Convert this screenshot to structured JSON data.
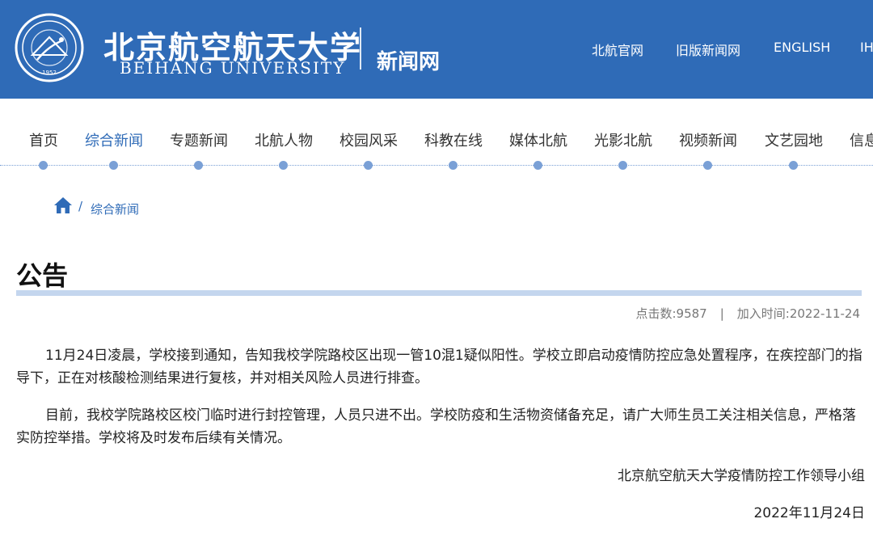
{
  "header": {
    "logo_cn": "北京航空航天大学",
    "logo_en": "BEIHANG UNIVERSITY",
    "site_name": "新闻网",
    "links": [
      "北航官网",
      "旧版新闻网",
      "ENGLISH",
      "IH"
    ]
  },
  "nav": {
    "items": [
      "首页",
      "综合新闻",
      "专题新闻",
      "北航人物",
      "校园风采",
      "科教在线",
      "媒体北航",
      "光影北航",
      "视频新闻",
      "文艺园地",
      "信息"
    ],
    "active": "综合新闻"
  },
  "breadcrumb": {
    "home_icon": "home-icon",
    "separator": "/",
    "current": "综合新闻"
  },
  "article": {
    "title": "公告",
    "views_label": "点击数:9587",
    "meta_separator": "|",
    "date_label": "加入时间:2022-11-24",
    "paragraphs": [
      "11月24日凌晨，学校接到通知，告知我校学院路校区出现一管10混1疑似阳性。学校立即启动疫情防控应急处置程序，在疾控部门的指导下，正在对核酸检测结果进行复核，并对相关风险人员进行排查。",
      "目前，我校学院路校区校门临时进行封控管理，人员只进不出。学校防疫和生活物资储备充足，请广大师生员工关注相关信息，严格落实防控举措。学校将及时发布后续有关情况。"
    ],
    "signature": "北京航空航天大学疫情防控工作领导小组",
    "date": "2022年11月24日"
  },
  "colors": {
    "brand_blue": "#2f6bb7",
    "nav_dot": "#7aa0d6",
    "title_bar": "#c4d6ee"
  }
}
